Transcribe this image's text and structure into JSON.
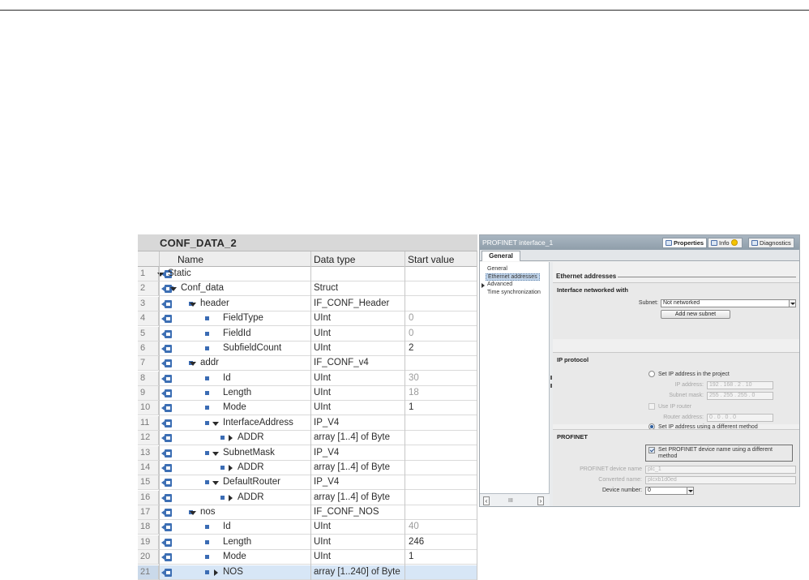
{
  "db": {
    "title": "CONF_DATA_2",
    "columns": {
      "name": "Name",
      "type": "Data type",
      "start": "Start value"
    },
    "rows": [
      {
        "num": "1",
        "name": "Static",
        "type": "",
        "value": ""
      },
      {
        "num": "2",
        "name": "Conf_data",
        "type": "Struct",
        "value": ""
      },
      {
        "num": "3",
        "name": "header",
        "type": "IF_CONF_Header",
        "value": ""
      },
      {
        "num": "4",
        "name": "FieldType",
        "type": "UInt",
        "value": "0"
      },
      {
        "num": "5",
        "name": "FieldId",
        "type": "UInt",
        "value": "0"
      },
      {
        "num": "6",
        "name": "SubfieldCount",
        "type": "UInt",
        "value": "2"
      },
      {
        "num": "7",
        "name": "addr",
        "type": "IF_CONF_v4",
        "value": ""
      },
      {
        "num": "8",
        "name": "Id",
        "type": "UInt",
        "value": "30"
      },
      {
        "num": "9",
        "name": "Length",
        "type": "UInt",
        "value": "18"
      },
      {
        "num": "10",
        "name": "Mode",
        "type": "UInt",
        "value": "1"
      },
      {
        "num": "11",
        "name": "InterfaceAddress",
        "type": "IP_V4",
        "value": ""
      },
      {
        "num": "12",
        "name": "ADDR",
        "type": "array [1..4] of Byte",
        "value": ""
      },
      {
        "num": "13",
        "name": "SubnetMask",
        "type": "IP_V4",
        "value": ""
      },
      {
        "num": "14",
        "name": "ADDR",
        "type": "array [1..4] of Byte",
        "value": ""
      },
      {
        "num": "15",
        "name": "DefaultRouter",
        "type": "IP_V4",
        "value": ""
      },
      {
        "num": "16",
        "name": "ADDR",
        "type": "array [1..4] of Byte",
        "value": ""
      },
      {
        "num": "17",
        "name": "nos",
        "type": "IF_CONF_NOS",
        "value": ""
      },
      {
        "num": "18",
        "name": "Id",
        "type": "UInt",
        "value": "40"
      },
      {
        "num": "19",
        "name": "Length",
        "type": "UInt",
        "value": "246"
      },
      {
        "num": "20",
        "name": "Mode",
        "type": "UInt",
        "value": "1"
      },
      {
        "num": "21",
        "name": "NOS",
        "type": "array [1..240] of Byte",
        "value": ""
      }
    ]
  },
  "props": {
    "window_title": "PROFINET interface_1",
    "tabs": {
      "properties": "Properties",
      "info": "Info",
      "diagnostics": "Diagnostics"
    },
    "general_tab": "General",
    "nav": {
      "general": "General",
      "ethernet": "Ethernet addresses",
      "advanced": "Advanced",
      "time_sync": "Time synchronization"
    },
    "nav_scroll_thumb": "III",
    "section_title": "Ethernet addresses",
    "interface": {
      "title": "Interface networked with",
      "subnet_label": "Subnet:",
      "subnet_value": "Not networked",
      "add_subnet": "Add new subnet"
    },
    "ip": {
      "title": "IP protocol",
      "set_in_project": "Set IP address in the project",
      "ip_label": "IP address:",
      "ip_value": "192 . 168 . 2 . 10",
      "mask_label": "Subnet mask:",
      "mask_value": "255 . 255 . 255 . 0",
      "use_router": "Use IP router",
      "router_label": "Router address:",
      "router_value": "0 . 0 . 0 . 0",
      "different_method": "Set IP address using a different method"
    },
    "profinet": {
      "title": "PROFINET",
      "set_name_different": "Set PROFINET device name using a different method",
      "device_name_label": "PROFINET device name",
      "device_name_value": "plc_1",
      "converted_label": "Converted name:",
      "converted_value": "plcxb1d0ed",
      "device_number_label": "Device number:",
      "device_number_value": "0"
    }
  }
}
